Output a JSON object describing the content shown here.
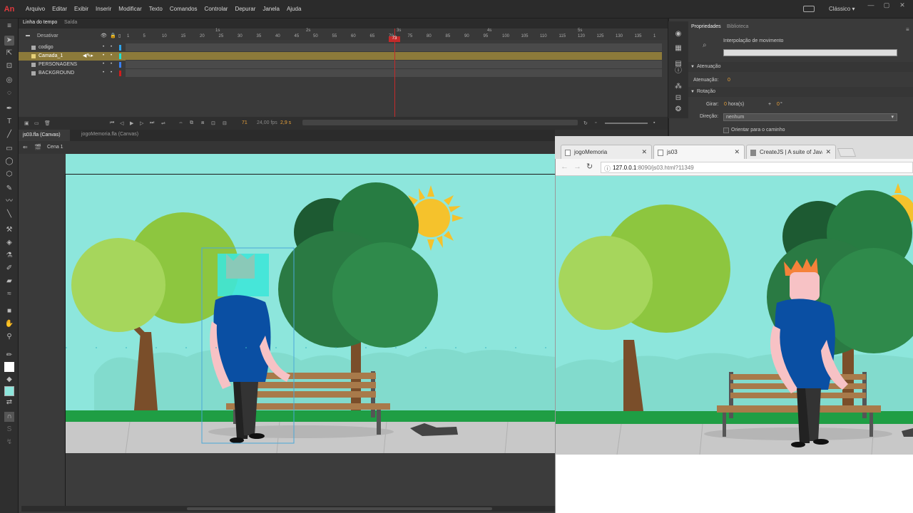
{
  "app": {
    "logo": "An"
  },
  "menu": [
    "Arquivo",
    "Editar",
    "Exibir",
    "Inserir",
    "Modificar",
    "Texto",
    "Comandos",
    "Controlar",
    "Depurar",
    "Janela",
    "Ajuda"
  ],
  "workspace": "Clássico",
  "timeline": {
    "tabs": [
      "Linha do tempo",
      "Saída"
    ],
    "header_label": "Desativar",
    "time_markers": [
      "1s",
      "2s",
      "3s",
      "4s",
      "5s"
    ],
    "frame_numbers": [
      "1",
      "5",
      "10",
      "15",
      "20",
      "25",
      "30",
      "35",
      "40",
      "45",
      "50",
      "55",
      "60",
      "65",
      "70",
      "75",
      "80",
      "85",
      "90",
      "95",
      "100",
      "105",
      "110",
      "115",
      "120",
      "125",
      "130",
      "135",
      "1"
    ],
    "current_frame": "73",
    "layers": [
      {
        "name": "codigo",
        "color": "#2ea4ea"
      },
      {
        "name": "Camada_1",
        "color": "#1fe0d6",
        "selected": true
      },
      {
        "name": "PERSONAGENS",
        "color": "#3a7ff0"
      },
      {
        "name": "BACKGROUND",
        "color": "#d11c1c"
      }
    ],
    "frame_readout": "71",
    "fps": "24,00 fps",
    "seconds": "2,9 s"
  },
  "properties": {
    "tabs": [
      "Propriedades",
      "Biblioteca"
    ],
    "title": "Interpolação de movimento",
    "sections": {
      "easing": "Atenuação",
      "rotation": "Rotação"
    },
    "easing_label": "Atenuação:",
    "easing_value": "0",
    "rotate_label": "Girar:",
    "rotate_hours": "0",
    "rotate_hours_unit": "hora(s)",
    "rotate_plus": "+",
    "rotate_deg": "0",
    "rotate_deg_unit": "°",
    "direction_label": "Direção:",
    "direction_value": "nenhum",
    "orient_label": "Orientar para o caminho"
  },
  "document": {
    "tabs": [
      "js03.fla (Canvas)",
      "jogoMemoria.fla (Canvas)"
    ],
    "scene": "Cena 1"
  },
  "browser": {
    "tabs": [
      {
        "title": "jogoMemoria",
        "active": false
      },
      {
        "title": "js03",
        "active": true
      },
      {
        "title": "CreateJS | A suite of Java",
        "active": false
      }
    ],
    "url_host": "127.0.0.1",
    "url_rest": ":8090/js03.html?11349"
  },
  "colors": {
    "sky": "#8de6dc",
    "grass": "#1f9e44",
    "sidewalk": "#c8c8c8",
    "sun": "#f5c22c",
    "playhead": "#c32a2a"
  }
}
